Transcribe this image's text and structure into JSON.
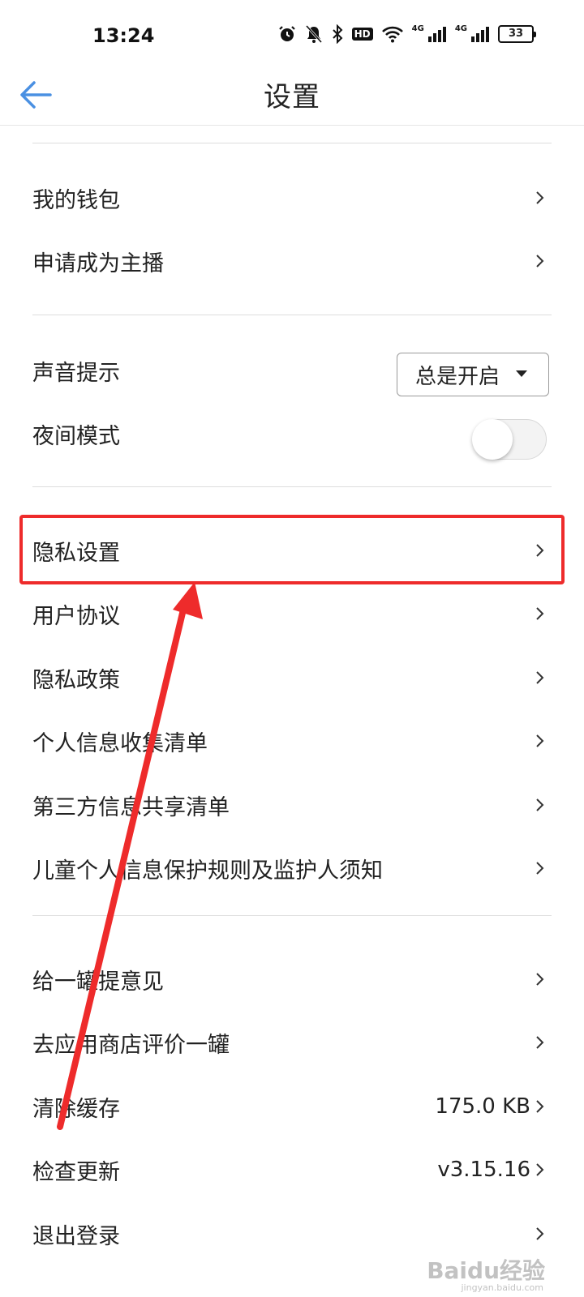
{
  "status_bar": {
    "time": "13:24",
    "hd": "HD",
    "signal_1": "4G",
    "signal_2": "4G",
    "battery": "33"
  },
  "header": {
    "title": "设置"
  },
  "menu": {
    "wallet": "我的钱包",
    "apply_anchor": "申请成为主播",
    "sound_alert": "声音提示",
    "sound_alert_value": "总是开启",
    "night_mode": "夜间模式",
    "night_mode_on": false,
    "privacy_settings": "隐私设置",
    "user_agreement": "用户协议",
    "privacy_policy": "隐私政策",
    "personal_info_list": "个人信息收集清单",
    "third_party_list": "第三方信息共享清单",
    "child_privacy": "儿童个人信息保护规则及监护人须知",
    "feedback": "给一罐提意见",
    "rate_app": "去应用商店评价一罐",
    "clear_cache": "清除缓存",
    "cache_size": "175.0 KB",
    "check_update": "检查更新",
    "version": "v3.15.16",
    "logout": "退出登录"
  },
  "annotation": {
    "highlight_color": "#ee2b2b"
  },
  "watermark": {
    "text": "Baidu经验",
    "sub": "jingyan.baidu.com"
  }
}
